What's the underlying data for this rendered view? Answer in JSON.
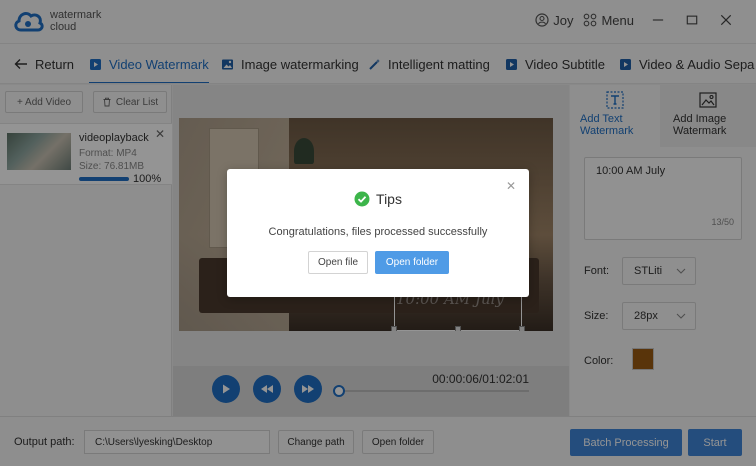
{
  "app": {
    "brand_line1": "watermark",
    "brand_line2": "cloud",
    "user": "Joy",
    "menu_label": "Menu",
    "logo_icon": "cloud-logo-icon"
  },
  "tabs": [
    {
      "label": "Return",
      "icon": "arrow-left-icon"
    },
    {
      "label": "Video Watermark",
      "icon": "video-icon",
      "active": true
    },
    {
      "label": "Image watermarking",
      "icon": "image-icon"
    },
    {
      "label": "Intelligent matting",
      "icon": "magic-wand-icon"
    },
    {
      "label": "Video Subtitle",
      "icon": "video-icon"
    },
    {
      "label": "Video & Audio Sepa",
      "icon": "video-icon"
    }
  ],
  "left_panel": {
    "add_video": "+ Add Video",
    "clear_list": "Clear List",
    "file": {
      "name": "videoplayback",
      "format": "Format:  MP4",
      "size": "Size:  76.81MB",
      "progress_text": "100%",
      "progress": 1.0
    }
  },
  "player": {
    "watermark_text": "10:00 AM July",
    "time": "00:00:06/01:02:01",
    "position": 0.0
  },
  "right_panel": {
    "tab_text": "Add Text Watermark",
    "tab_image": "Add Image Watermark",
    "text_value": "10:00 AM July",
    "char_count": "13/50",
    "font_label": "Font:",
    "font_value": "STLiti",
    "size_label": "Size:",
    "size_value": "28px",
    "color_label": "Color:",
    "color_value": "#9a5a12"
  },
  "bottom": {
    "output_label": "Output path:",
    "output_path": "C:\\Users\\lyesking\\Desktop",
    "change_path": "Change path",
    "open_folder": "Open folder",
    "batch": "Batch Processing",
    "start": "Start"
  },
  "dialog": {
    "title": "Tips",
    "message": "Congratulations, files processed successfully",
    "open_file": "Open file",
    "open_folder": "Open folder"
  },
  "colors": {
    "accent": "#1f6fc4",
    "primary_button": "#3f86d8",
    "success": "#3cb54a"
  }
}
